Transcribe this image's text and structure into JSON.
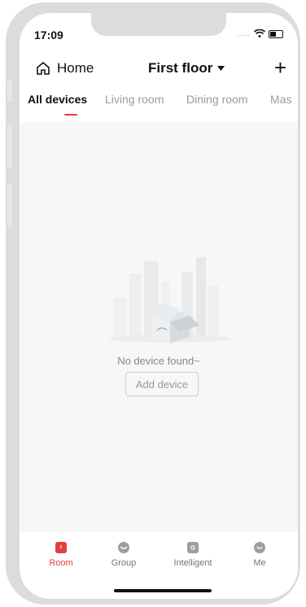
{
  "status_bar": {
    "time": "17:09",
    "signal_dots": "....."
  },
  "header": {
    "home_label": "Home",
    "floor_label": "First floor",
    "add_label": "+"
  },
  "tabs": [
    {
      "label": "All devices",
      "active": true
    },
    {
      "label": "Living room",
      "active": false
    },
    {
      "label": "Dining room",
      "active": false
    },
    {
      "label": "Mas",
      "active": false
    }
  ],
  "empty_state": {
    "message": "No device found~",
    "button_label": "Add device"
  },
  "bottom_nav": [
    {
      "label": "Room",
      "icon": "room-icon",
      "active": true
    },
    {
      "label": "Group",
      "icon": "group-icon",
      "active": false
    },
    {
      "label": "Intelligent",
      "icon": "intelligent-icon",
      "active": false
    },
    {
      "label": "Me",
      "icon": "me-icon",
      "active": false
    }
  ],
  "colors": {
    "accent": "#e04040",
    "background": "#f7f7f7"
  }
}
